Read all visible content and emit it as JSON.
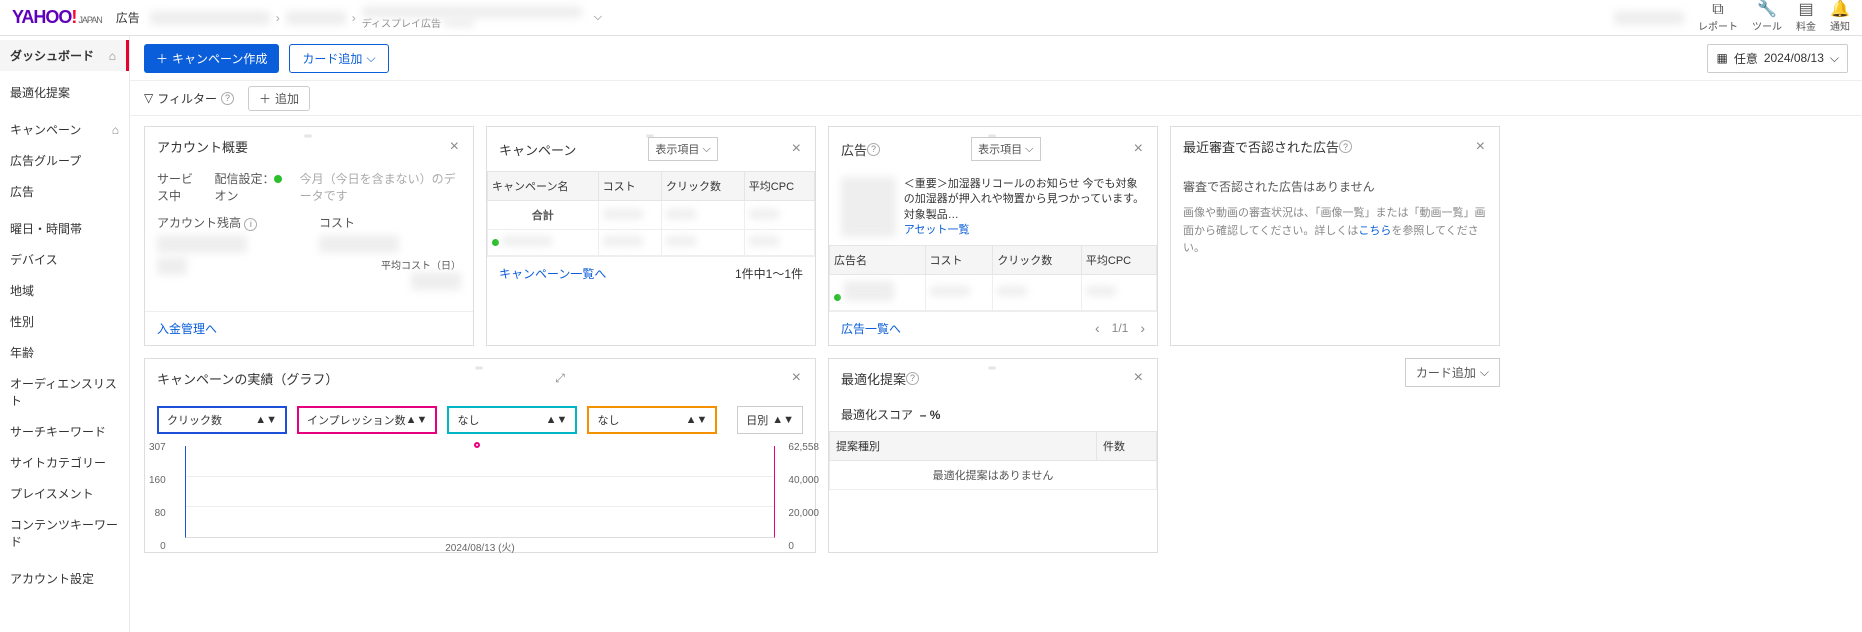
{
  "header": {
    "logo_main": "YAHOO",
    "logo_excl": "!",
    "logo_japan": "JAPAN",
    "ad_label": "広告",
    "breadcrumb_sub": "ディスプレイ広告",
    "top_right": {
      "report": "レポート",
      "tool": "ツール",
      "fee": "料金",
      "notif": "通知"
    }
  },
  "sidebar": {
    "dashboard": "ダッシュボード",
    "optimize": "最適化提案",
    "campaign": "キャンペーン",
    "adgroup": "広告グループ",
    "ad": "広告",
    "dow": "曜日・時間帯",
    "device": "デバイス",
    "region": "地域",
    "gender": "性別",
    "age": "年齢",
    "audience": "オーディエンスリスト",
    "searchkw": "サーチキーワード",
    "sitecat": "サイトカテゴリー",
    "placement": "プレイスメント",
    "contentkw": "コンテンツキーワード",
    "account": "アカウント設定"
  },
  "toolbar": {
    "create_campaign": "キャンペーン作成",
    "add_card": "カード追加",
    "date_prefix": "任意",
    "date_value": "2024/08/13"
  },
  "filter": {
    "label": "フィルター",
    "add": "追加"
  },
  "cards": {
    "account": {
      "title": "アカウント概要",
      "service": "サービス中",
      "delivery_label": "配信設定：",
      "delivery_val": "オン",
      "period": "今月（今日を含まない）のデータです",
      "balance_label": "アカウント残高",
      "cost_label": "コスト",
      "avg_cost_label": "平均コスト（日）",
      "footer_link": "入金管理へ"
    },
    "campaign": {
      "title": "キャンペーン",
      "display_items": "表示項目",
      "cols": {
        "name": "キャンペーン名",
        "cost": "コスト",
        "clicks": "クリック数",
        "cpc": "平均CPC"
      },
      "total_label": "合計",
      "footer_link": "キャンペーン一覧へ",
      "footer_count": "1件中1～1件"
    },
    "ad": {
      "title": "広告",
      "display_items": "表示項目",
      "notice": "＜重要＞加湿器リコールのお知らせ 今でも対象の加湿器が押入れや物置から見つかっています。対象製品…",
      "asset_link": "アセット一覧",
      "cols": {
        "name": "広告名",
        "cost": "コスト",
        "clicks": "クリック数",
        "cpc": "平均CPC"
      },
      "footer_link": "広告一覧へ",
      "pager": "1/1"
    },
    "review": {
      "title": "最近審査で否認された広告",
      "line1": "審査で否認された広告はありません",
      "line2a": "画像や動画の審査状況は、「画像一覧」または「動画一覧」画面から確認してください。詳しくは",
      "line2_link": "こちら",
      "line2b": "を参照してください。"
    },
    "graph": {
      "title": "キャンペーンの実績（グラフ）",
      "m1": "クリック数",
      "m2": "インプレッション数",
      "m3": "なし",
      "m4": "なし",
      "period": "日別",
      "y_left": [
        "307",
        "160",
        "80",
        "0"
      ],
      "y_right": [
        "62,558",
        "40,000",
        "20,000",
        "0"
      ],
      "x_label": "2024/08/13 (火)"
    },
    "optimize": {
      "title": "最適化提案",
      "score_label": "最適化スコア",
      "score_val": "– %",
      "col_type": "提案種別",
      "col_count": "件数",
      "empty": "最適化提案はありません"
    },
    "add_card_btn": "カード追加"
  },
  "chart_data": {
    "type": "line",
    "x": [
      "2024/08/13 (火)"
    ],
    "series": [
      {
        "name": "クリック数",
        "values": [
          null
        ],
        "axis": "left",
        "color": "#1e4fd9"
      },
      {
        "name": "インプレッション数",
        "values": [
          62000
        ],
        "axis": "right",
        "color": "#e6007e"
      }
    ],
    "y_left_range": [
      0,
      307
    ],
    "y_right_range": [
      0,
      62558
    ],
    "y_left_ticks": [
      0,
      80,
      160,
      307
    ],
    "y_right_ticks": [
      0,
      20000,
      40000,
      62558
    ]
  }
}
